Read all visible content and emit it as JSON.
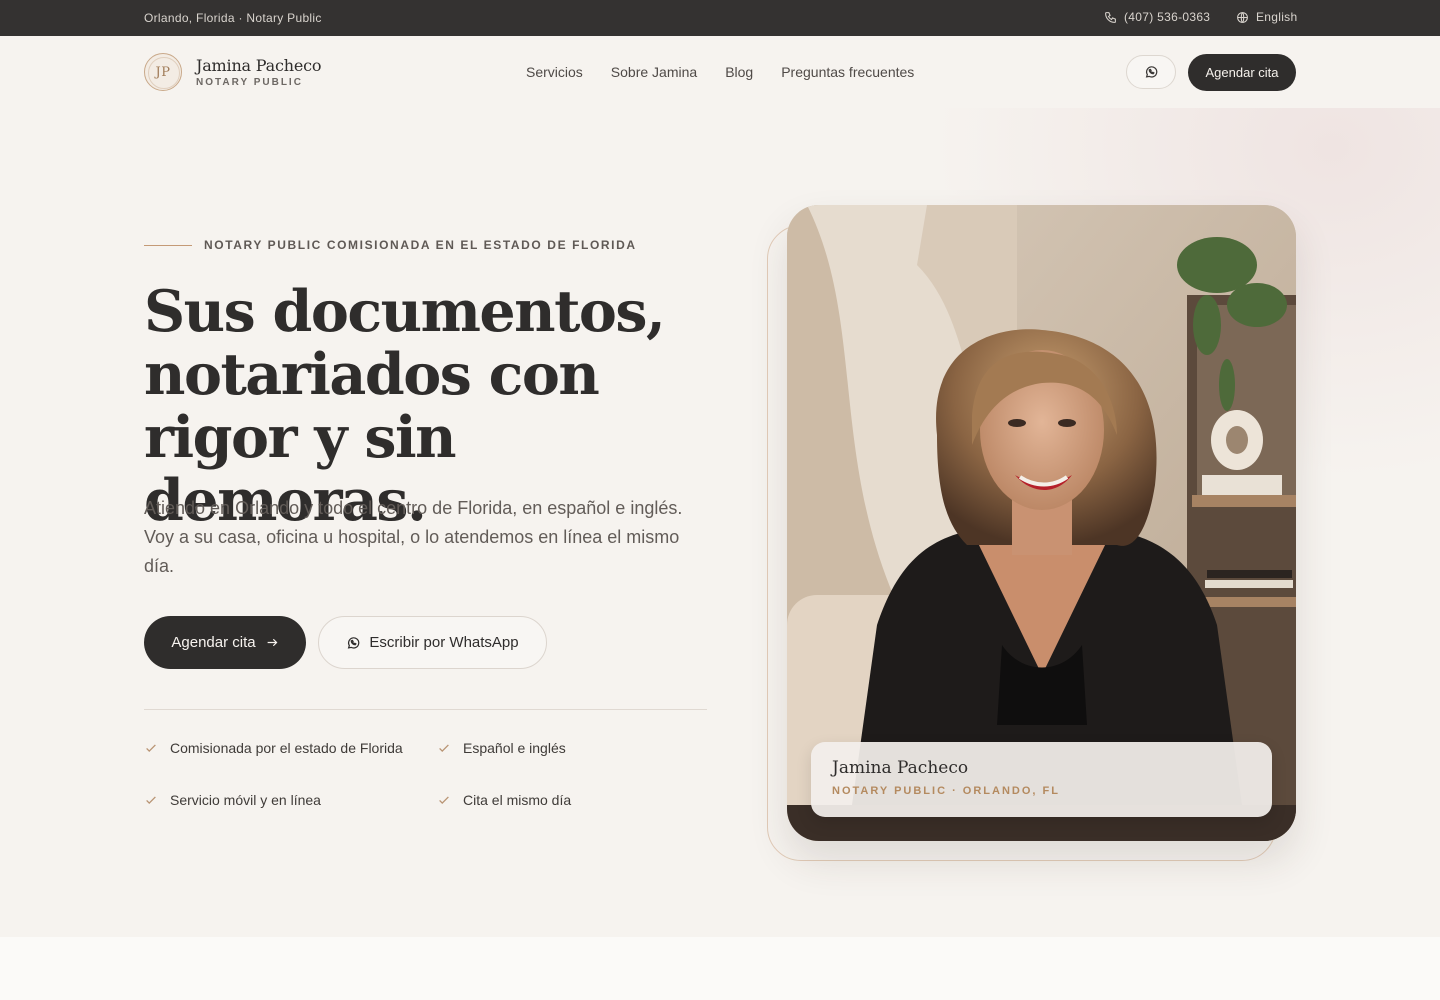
{
  "topbar": {
    "location": "Orlando, Florida · Notary Public",
    "phone": "(407) 536-0363",
    "language": "English"
  },
  "header": {
    "logo_initials": "JP",
    "logo_name": "Jamina Pacheco",
    "logo_subtitle": "NOTARY PUBLIC",
    "nav": [
      "Servicios",
      "Sobre Jamina",
      "Blog",
      "Preguntas frecuentes"
    ],
    "cta": "Agendar cita"
  },
  "hero": {
    "eyebrow": "NOTARY PUBLIC COMISIONADA EN EL ESTADO DE FLORIDA",
    "title_lines": [
      "Sus documentos,",
      "notariados con",
      "rigor y sin demoras."
    ],
    "lead": "Atiendo en Orlando y todo el centro de Florida, en español e inglés. Voy a su casa, oficina u hospital, o lo atendemos en línea el mismo día.",
    "primary_button": "Agendar cita",
    "secondary_button": "Escribir por WhatsApp",
    "features": [
      "Comisionada por el estado de Florida",
      "Español e inglés",
      "Servicio móvil y en línea",
      "Cita el mismo día"
    ]
  },
  "portrait_card": {
    "name": "Jamina Pacheco",
    "role": "NOTARY PUBLIC · ORLANDO, FL"
  },
  "icons": {
    "phone": "phone-icon",
    "language": "globe-icon",
    "whatsapp": "whatsapp-icon",
    "arrow": "arrow-right-icon",
    "check": "check-icon"
  },
  "colors": {
    "background": "#f6f3ef",
    "dark": "#2f2d2c",
    "accent": "#b48a5f"
  }
}
